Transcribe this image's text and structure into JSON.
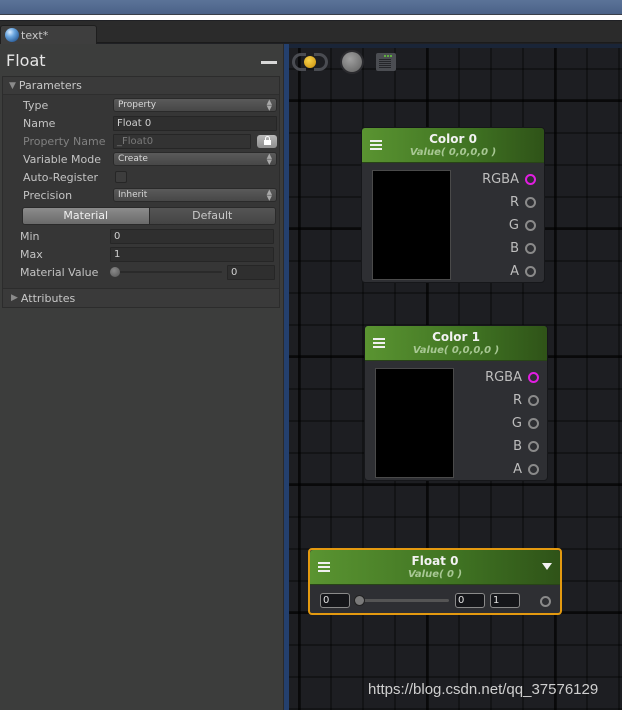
{
  "window": {
    "tab_label": "text*"
  },
  "graph_toolbar": {
    "buttons": [
      {
        "icon": "live-preview-icon"
      },
      {
        "icon": "record-icon"
      },
      {
        "icon": "console-icon"
      }
    ]
  },
  "inspector": {
    "title": "Float",
    "parameters_label": "Parameters",
    "attributes_label": "Attributes",
    "fields": {
      "type_label": "Type",
      "type_value": "Property",
      "name_label": "Name",
      "name_value": "Float 0",
      "property_name_label": "Property Name",
      "property_name_value": "_Float0",
      "variable_mode_label": "Variable Mode",
      "variable_mode_value": "Create",
      "auto_register_label": "Auto-Register",
      "auto_register_checked": false,
      "precision_label": "Precision",
      "precision_value": "Inherit",
      "toggle_material": "Material",
      "toggle_default": "Default",
      "toggle_selected": "Material",
      "min_label": "Min",
      "min_value": "0",
      "max_label": "Max",
      "max_value": "1",
      "material_value_label": "Material Value",
      "material_value": "0"
    }
  },
  "nodes": [
    {
      "title": "Color 0",
      "subtitle": "Value( 0,0,0,0 )",
      "ports": [
        "RGBA",
        "R",
        "G",
        "B",
        "A"
      ]
    },
    {
      "title": "Color 1",
      "subtitle": "Value( 0,0,0,0 )",
      "ports": [
        "RGBA",
        "R",
        "G",
        "B",
        "A"
      ]
    },
    {
      "title": "Float 0",
      "subtitle": "Value( 0 )",
      "min": "0",
      "value": "0",
      "max": "1",
      "selected": true
    }
  ],
  "watermark": "https://blog.csdn.net/qq_37576129",
  "colors": {
    "node_header_green": "#4e8a2a",
    "selection_orange": "#e49a10",
    "rgba_port_magenta": "#e11ee1",
    "graph_border_blue": "#24406e"
  }
}
